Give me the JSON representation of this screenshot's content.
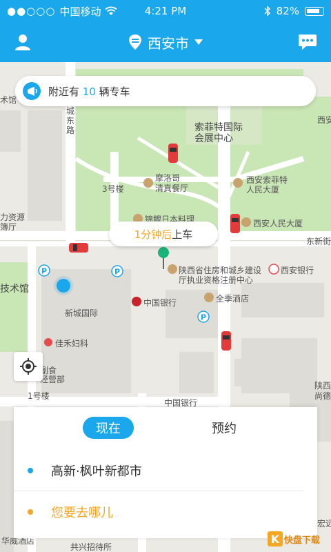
{
  "status": {
    "carrier": "中国移动",
    "time": "4:21 PM",
    "battery": "82%"
  },
  "header": {
    "city": "西安市",
    "icons": [
      "user-icon",
      "location-pin-icon",
      "dropdown-icon",
      "chat-icon"
    ]
  },
  "nearby": {
    "prefix": "附近有",
    "count": "10",
    "suffix": "辆专车"
  },
  "pickup": {
    "time": "1分钟后",
    "action": "上车"
  },
  "map_labels": {
    "l1": "城东路",
    "l2": "索菲特国际",
    "l3": "会展中心",
    "l4": "3号楼",
    "l5": "摩洛哥",
    "l6": "清真餐厅",
    "l7": "西安索菲特",
    "l8": "人民大厦",
    "l9": "锦鲤日本料理",
    "l10": "西安人民大厦",
    "l11": "东新街",
    "l12": "陕西省住房和城乡建设",
    "l13": "厅执业资格注册中心",
    "l14": "西安银行",
    "l15": "技术馆",
    "l16": "新城国际",
    "l17": "中国银行",
    "l18": "全季酒店",
    "l19": "佳禾妇科",
    "l20": "副食",
    "l21": "经营部",
    "l22": "1号楼",
    "l23": "中国银行",
    "l24": "陕西",
    "l25": "尚德",
    "l26": "华威酒店",
    "l27": "共兴招待所",
    "l28": "宏远",
    "l29": "西安",
    "l30": "力资源",
    "l31": "簿厅",
    "l32": "术馆"
  },
  "tabs": {
    "now": "现在",
    "reserve": "预约"
  },
  "from": "高新·枫叶新都市",
  "to_placeholder": "您要去哪儿",
  "watermark": "快盘下载",
  "colors": {
    "accent": "#1aa7ec",
    "orange": "#f5a623",
    "green_marker": "#1bb37a"
  }
}
